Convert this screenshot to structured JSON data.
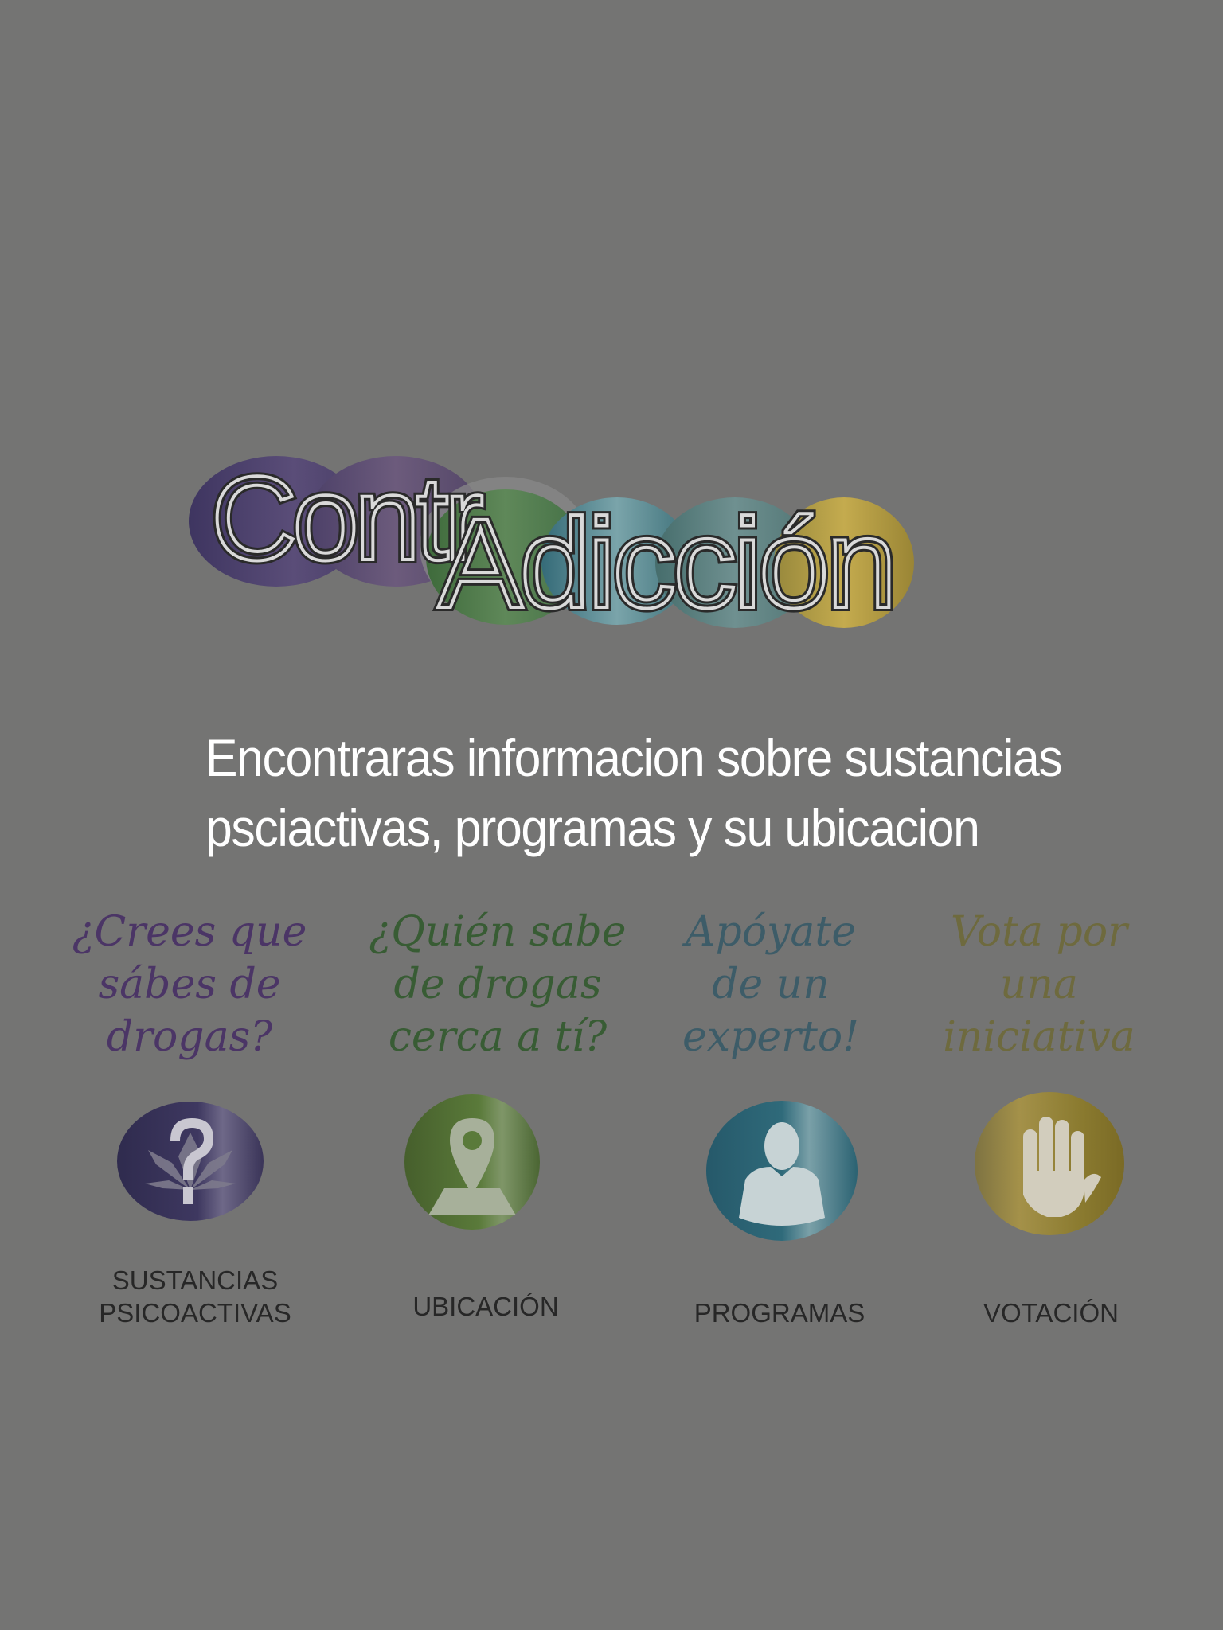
{
  "logo": {
    "text": "ContrAdicción",
    "part1": "Contr",
    "part2": "Adicción"
  },
  "description": {
    "line1": "Encontraras informacion sobre sustancias",
    "line2": "psciactivas, programas y su ubicacion"
  },
  "menu": [
    {
      "tagline": [
        "¿Crees que",
        "sábes de",
        "drogas?"
      ],
      "label": [
        "SUSTANCIAS",
        "PSICOACTIVAS"
      ],
      "icon": "question-leaf-icon",
      "color": "#3b3457"
    },
    {
      "tagline": [
        "¿Quién sabe",
        "de drogas",
        "cerca a tí?"
      ],
      "label": [
        "UBICACIÓN"
      ],
      "icon": "map-pin-icon",
      "color": "#4e6a35"
    },
    {
      "tagline": [
        "Apóyate",
        "de un",
        "experto!"
      ],
      "label": [
        "PROGRAMAS"
      ],
      "icon": "expert-person-icon",
      "color": "#2f6674"
    },
    {
      "tagline": [
        "Vota por",
        "una",
        "iniciativa"
      ],
      "label": [
        "VOTACIÓN"
      ],
      "icon": "raised-hand-icon",
      "color": "#8a7a2e"
    }
  ]
}
